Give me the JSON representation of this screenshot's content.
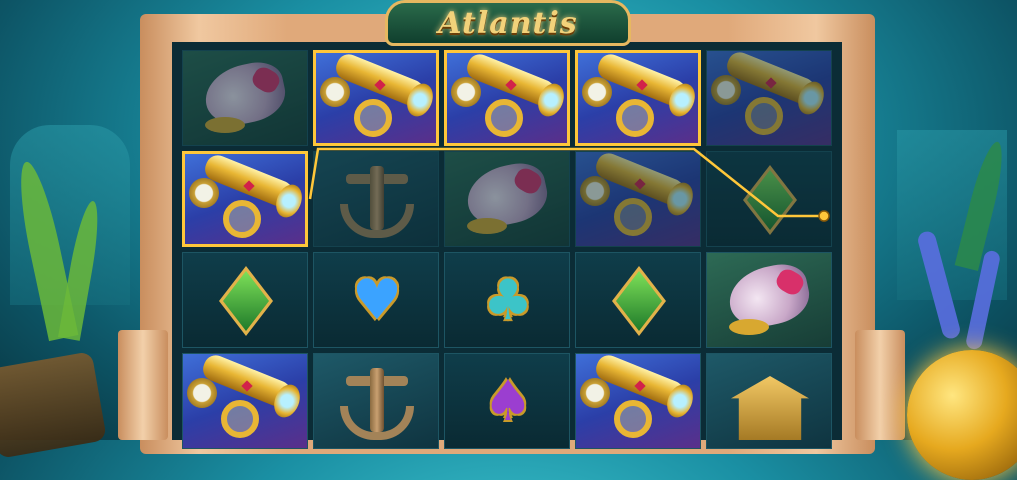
{
  "game": {
    "title": "Atlantis"
  },
  "reels": [
    {
      "index": 1,
      "symbols": [
        "shell",
        "spyglass",
        "diamond",
        "spyglass"
      ]
    },
    {
      "index": 2,
      "symbols": [
        "spyglass",
        "anchor",
        "heart",
        "anchor"
      ]
    },
    {
      "index": 3,
      "symbols": [
        "spyglass",
        "shell",
        "club",
        "spade"
      ]
    },
    {
      "index": 4,
      "symbols": [
        "spyglass",
        "spyglass",
        "diamond",
        "spyglass"
      ]
    },
    {
      "index": 5,
      "symbols": [
        "spyglass",
        "diamond",
        "shell",
        "temple"
      ]
    }
  ],
  "winning_line": {
    "symbol": "spyglass",
    "cells": [
      {
        "reel": 1,
        "row": 2
      },
      {
        "reel": 2,
        "row": 1
      },
      {
        "reel": 3,
        "row": 1
      },
      {
        "reel": 4,
        "row": 1
      }
    ]
  },
  "colors": {
    "win_highlight": "#ffc73a",
    "water": "#1a8fa3",
    "frame": "#e0a97a"
  }
}
